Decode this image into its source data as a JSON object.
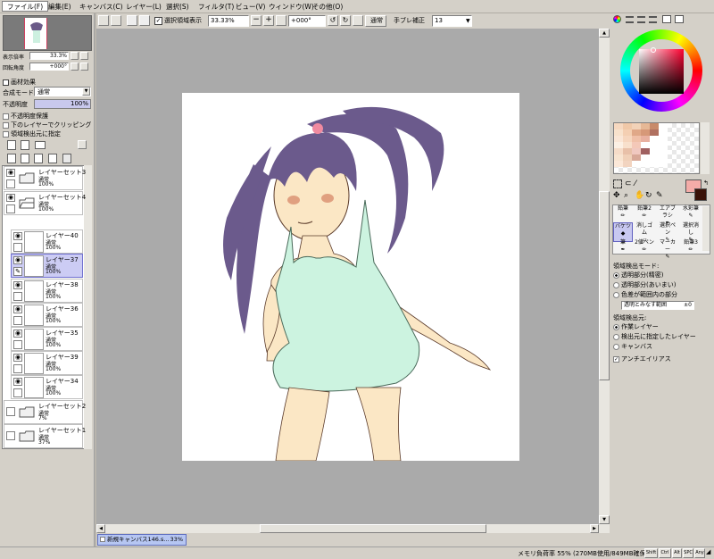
{
  "menu": [
    "ファイル(F)",
    "編集(E)",
    "キャンバス(C)",
    "レイヤー(L)",
    "選択(S)",
    "フィルタ(T)",
    "ビュー(V)",
    "ウィンドウ(W)",
    "その他(O)"
  ],
  "toolbar": {
    "select_region_label": "選択領域表示",
    "zoom_value": "33.33%",
    "rotate_value": "+000°",
    "blend_value": "通常",
    "stabilizer_label": "手ブレ補正",
    "stabilizer_value": "13"
  },
  "navigator": {
    "zoom_label": "表示倍率",
    "zoom_value": "33.3%",
    "rotate_label": "回転角度",
    "rotate_value": "+000°"
  },
  "layer_panel": {
    "paper_effect": "画材効果",
    "blend_mode_label": "合成モード",
    "blend_mode_value": "通常",
    "opacity_label": "不透明度",
    "opacity_value": "100%",
    "opts": [
      "不透明度保護",
      "下のレイヤーでクリッピング",
      "領域検出元に指定"
    ],
    "layers": [
      {
        "name": "レイヤーセット3",
        "mode": "通常",
        "opacity": "100%"
      },
      {
        "name": "レイヤーセット4",
        "mode": "通常",
        "opacity": "100%"
      },
      {
        "name": "レイヤー40",
        "mode": "通常",
        "opacity": "100%"
      },
      {
        "name": "レイヤー37",
        "mode": "通常",
        "opacity": "100%"
      },
      {
        "name": "レイヤー38",
        "mode": "通常",
        "opacity": "100%"
      },
      {
        "name": "レイヤー36",
        "mode": "通常",
        "opacity": "100%"
      },
      {
        "name": "レイヤー35",
        "mode": "通常",
        "opacity": "100%"
      },
      {
        "name": "レイヤー39",
        "mode": "通常",
        "opacity": "100%"
      },
      {
        "name": "レイヤー34",
        "mode": "通常",
        "opacity": "100%"
      },
      {
        "name": "レイヤーセット2",
        "mode": "通常",
        "opacity": "7%"
      },
      {
        "name": "レイヤーセット1",
        "mode": "通常",
        "opacity": "37%"
      }
    ]
  },
  "tools": {
    "row1": [
      "鉛筆",
      "鉛筆2",
      "エアブラシ",
      "水彩筆"
    ],
    "row2": [
      "バケツ",
      "消しゴム",
      "選択ペン",
      "選択消し"
    ],
    "row3": [
      "筆",
      "2値ペン",
      "マーカー",
      "鉛筆3"
    ]
  },
  "tool_options": {
    "detect_mode_label": "領域検出モード:",
    "detect_modes": [
      "透明部分(精密)",
      "透明部分(あいまい)",
      "色差が範囲内の部分"
    ],
    "transparent_range_label": "透明とみなす範囲",
    "transparent_range_value": "±0",
    "detect_source_label": "領域検出元:",
    "detect_sources": [
      "作業レイヤー",
      "検出元に指定したレイヤー",
      "キャンバス"
    ],
    "antialias_label": "アンチエイリアス"
  },
  "tab": {
    "title": "新規キャンバス146.s...",
    "zoom": "33%"
  },
  "status": {
    "memory": "メモリ負荷率 55% (270MB使用/849MB確保)",
    "keys": [
      "Shift",
      "Ctrl",
      "Alt",
      "SPC",
      "Any"
    ]
  }
}
